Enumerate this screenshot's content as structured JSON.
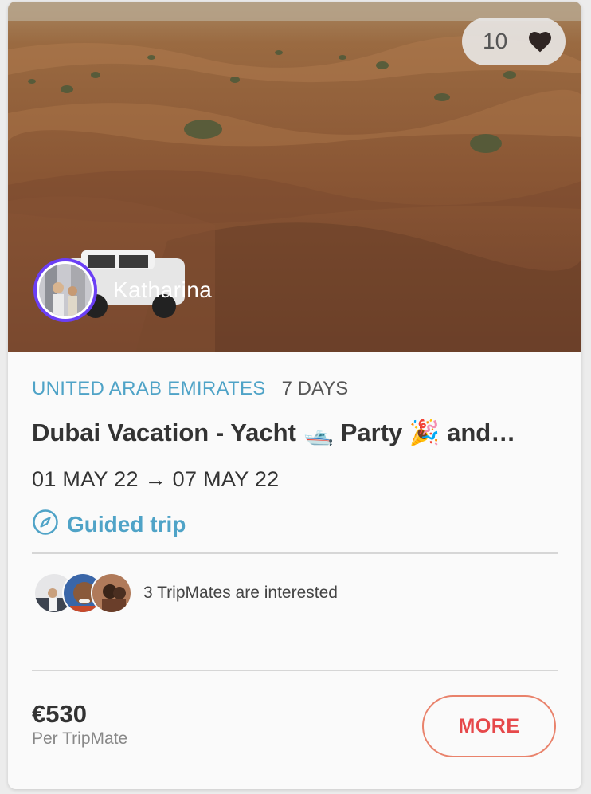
{
  "trip": {
    "likes_count": "10",
    "host_name": "Katharina",
    "country": "UNITED ARAB EMIRATES",
    "duration": "7 DAYS",
    "title": "Dubai Vacation - Yacht 🛥️ Party 🎉 and…",
    "dates": "01 MAY 22 → 07 MAY 22",
    "guided_label": "Guided trip",
    "interested_text": "3 TripMates are interested",
    "price": "€530",
    "price_unit": "Per TripMate",
    "more_label": "MORE"
  },
  "icons": {
    "like": "heart-icon",
    "guided": "compass-icon"
  },
  "colors": {
    "accent_blue": "#4fa3c7",
    "host_ring": "#6b3ff5",
    "more_text": "#e6484a",
    "more_border": "#e9826b"
  }
}
